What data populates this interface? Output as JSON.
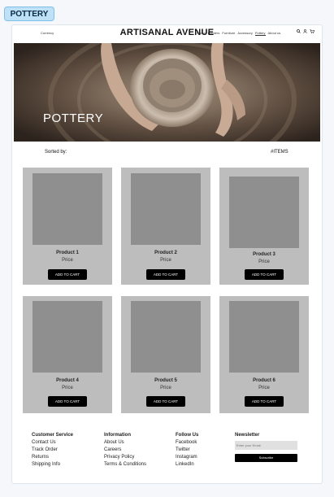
{
  "frame_label": "POTTERY",
  "header": {
    "currency": "Currency",
    "brand": "ARTISANAL AVENUE",
    "nav": [
      "Home",
      "Planters",
      "Furniture",
      "Accessory",
      "Pottery",
      "About us"
    ],
    "active_nav": "Pottery",
    "icons": [
      "search-icon",
      "user-icon",
      "cart-icon"
    ]
  },
  "hero": {
    "title": "POTTERY"
  },
  "listing": {
    "sorted_by": "Sorted by:",
    "items_count": "#ITEMS"
  },
  "products": [
    {
      "name": "Product 1",
      "price": "Price",
      "button": "ADD TO CART"
    },
    {
      "name": "Product 2",
      "price": "Price",
      "button": "ADD TO CART"
    },
    {
      "name": "Product 3",
      "price": "Price",
      "button": "ADD TO CART"
    },
    {
      "name": "Product 4",
      "price": "Price",
      "button": "ADD TO CART"
    },
    {
      "name": "Product 5",
      "price": "Price",
      "button": "ADD TO CART"
    },
    {
      "name": "Product 6",
      "price": "Price",
      "button": "ADD TO CART"
    }
  ],
  "footer": {
    "customer_service": {
      "title": "Customer Service",
      "links": [
        "Contact Us",
        "Track Order",
        "Returns",
        "Shipping Info"
      ]
    },
    "information": {
      "title": "Information",
      "links": [
        "About Us",
        "Careers",
        "Privacy Policy",
        "Terms & Conditions"
      ]
    },
    "follow_us": {
      "title": "Follow Us",
      "links": [
        "Facebook",
        "Twitter",
        "Instagram",
        "LinkedIn"
      ]
    },
    "newsletter": {
      "title": "Newsletter",
      "placeholder": "Enter your Email",
      "button": "Subscribe"
    }
  }
}
